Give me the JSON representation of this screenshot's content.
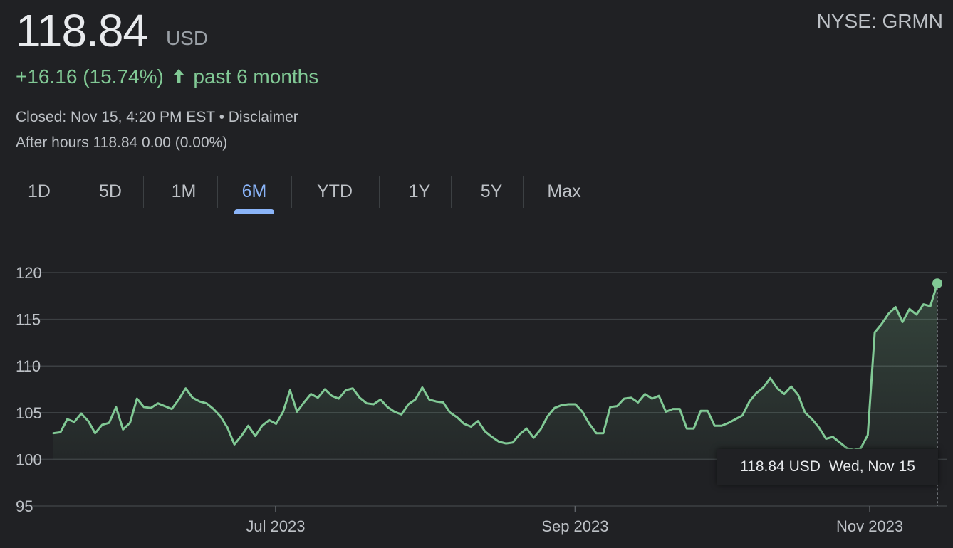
{
  "quote": {
    "price": "118.84",
    "currency": "USD",
    "ticker": "NYSE: GRMN",
    "change": "+16.16 (15.74%)",
    "change_period": "past 6 months",
    "closed": "Closed: Nov 15, 4:20 PM EST • Disclaimer",
    "after_hours": "After hours 118.84 0.00 (0.00%)",
    "positive_color": "#81c995",
    "arrow_icon": "arrow-up-icon"
  },
  "tabs": [
    {
      "label": "1D",
      "active": false
    },
    {
      "label": "5D",
      "active": false
    },
    {
      "label": "1M",
      "active": false
    },
    {
      "label": "6M",
      "active": true
    },
    {
      "label": "YTD",
      "active": false
    },
    {
      "label": "1Y",
      "active": false
    },
    {
      "label": "5Y",
      "active": false
    },
    {
      "label": "Max",
      "active": false
    }
  ],
  "tooltip": {
    "value": "118.84 USD",
    "date": "Wed, Nov 15"
  },
  "chart_data": {
    "type": "area",
    "x_start": "2023-05-16",
    "x_end": "2023-11-15",
    "ylim": [
      95,
      120
    ],
    "yticks": [
      120,
      115,
      110,
      105,
      100,
      95
    ],
    "xticks": [
      {
        "label": "Jul 2023",
        "date": "2023-07-01"
      },
      {
        "label": "Sep 2023",
        "date": "2023-09-01"
      },
      {
        "label": "Nov 2023",
        "date": "2023-11-01"
      }
    ],
    "grid": true,
    "line_color": "#81c995",
    "series": [
      {
        "values": [
          102.8,
          102.9,
          104.3,
          104.0,
          104.9,
          104.1,
          102.8,
          103.7,
          103.9,
          105.6,
          103.2,
          103.9,
          106.5,
          105.6,
          105.5,
          106.0,
          105.7,
          105.4,
          106.4,
          107.6,
          106.6,
          106.2,
          106.0,
          105.4,
          104.6,
          103.4,
          101.6,
          102.5,
          103.6,
          102.5,
          103.6,
          104.2,
          103.8,
          105.1,
          107.4,
          105.1,
          106.1,
          107.0,
          106.6,
          107.5,
          106.8,
          106.5,
          107.4,
          107.6,
          106.6,
          106.0,
          105.9,
          106.4,
          105.6,
          105.1,
          104.8,
          105.9,
          106.4,
          107.7,
          106.4,
          106.2,
          106.1,
          105.0,
          104.5,
          103.8,
          103.5,
          104.1,
          103.0,
          102.4,
          101.9,
          101.7,
          101.8,
          102.7,
          103.3,
          102.3,
          103.2,
          104.6,
          105.5,
          105.8,
          105.9,
          105.9,
          105.1,
          103.8,
          102.8,
          102.8,
          105.6,
          105.7,
          106.5,
          106.6,
          106.1,
          107.0,
          106.5,
          106.8,
          105.1,
          105.4,
          105.4,
          103.3,
          103.3,
          105.2,
          105.2,
          103.6,
          103.6,
          103.9,
          104.3,
          104.7,
          106.2,
          107.1,
          107.7,
          108.7,
          107.6,
          107.0,
          107.8,
          106.9,
          105.0,
          104.3,
          103.4,
          102.2,
          102.4,
          101.8,
          101.2,
          101.0,
          101.2,
          102.6,
          113.6,
          114.5,
          115.6,
          116.3,
          114.7,
          116.1,
          115.5,
          116.6,
          116.4,
          118.84
        ]
      }
    ]
  }
}
